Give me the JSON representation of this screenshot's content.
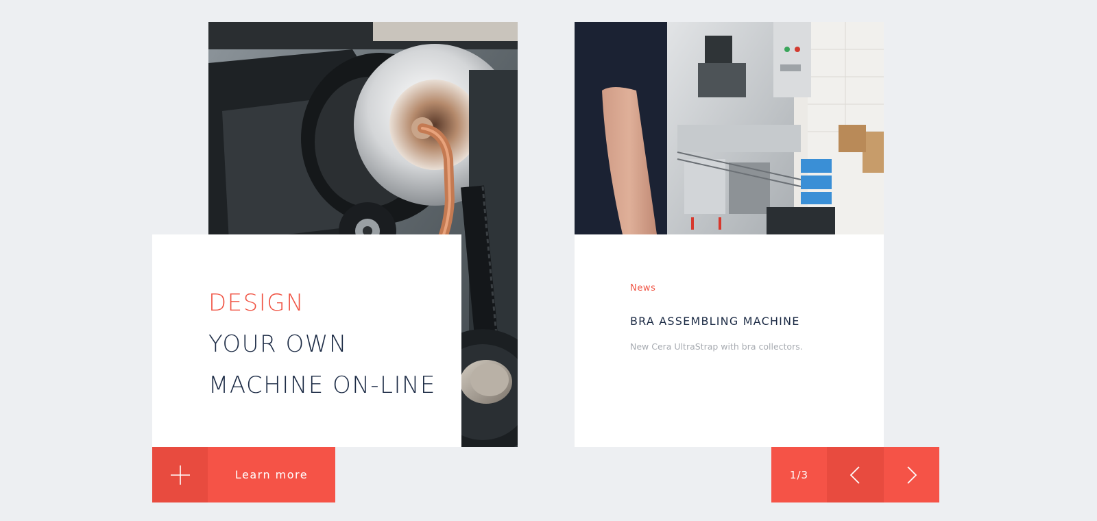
{
  "hero": {
    "title_accent": "DESIGN",
    "title_line2": "YOUR OWN",
    "title_line3": "MACHINE ON-LINE",
    "learn_more_label": "Learn more"
  },
  "news": {
    "tag": "News",
    "title": "BRA ASSEMBLING MACHINE",
    "description": "New Cera UltraStrap with bra collectors."
  },
  "pager": {
    "counter": "1/3"
  },
  "colors": {
    "accent": "#f55347",
    "accent_dark": "#e84b3f",
    "heading": "#1c2b45",
    "muted": "#a7abb1",
    "background": "#edeff2"
  },
  "icons": {
    "learn_more": "plus-icon",
    "prev": "chevron-left-icon",
    "next": "chevron-right-icon"
  }
}
